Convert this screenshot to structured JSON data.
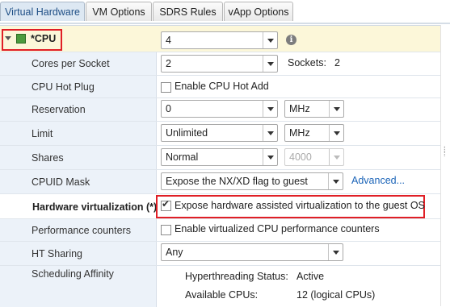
{
  "tabs": [
    "Virtual Hardware",
    "VM Options",
    "SDRS Rules",
    "vApp Options"
  ],
  "cpu": {
    "label": "*CPU",
    "value": "4",
    "info_icon": "i"
  },
  "cores_per_socket": {
    "label": "Cores per Socket",
    "value": "2",
    "sockets_label": "Sockets:",
    "sockets_value": "2"
  },
  "cpu_hot_plug": {
    "label": "CPU Hot Plug",
    "checkbox_label": "Enable CPU Hot Add",
    "checked": false
  },
  "reservation": {
    "label": "Reservation",
    "value": "0",
    "unit": "MHz"
  },
  "limit": {
    "label": "Limit",
    "value": "Unlimited",
    "unit": "MHz"
  },
  "shares": {
    "label": "Shares",
    "value": "Normal",
    "amount": "4000"
  },
  "cpuid_mask": {
    "label": "CPUID Mask",
    "value": "Expose the NX/XD flag to guest",
    "advanced_link": "Advanced..."
  },
  "hardware_virtualization": {
    "label": "Hardware virtualization (*)",
    "checkbox_label": "Expose hardware assisted virtualization to the guest OS",
    "checked": true
  },
  "performance_counters": {
    "label": "Performance counters",
    "checkbox_label": "Enable virtualized CPU performance counters",
    "checked": false
  },
  "ht_sharing": {
    "label": "HT Sharing",
    "value": "Any"
  },
  "scheduling_affinity": {
    "label": "Scheduling Affinity",
    "hyperthreading_label": "Hyperthreading Status:",
    "hyperthreading_value": "Active",
    "available_cpus_label": "Available CPUs:",
    "available_cpus_value": "12 (logical CPUs)"
  },
  "colors": {
    "highlight_box": "#e01f26",
    "label_column": "#ecf2f9",
    "link": "#1b64b8"
  }
}
